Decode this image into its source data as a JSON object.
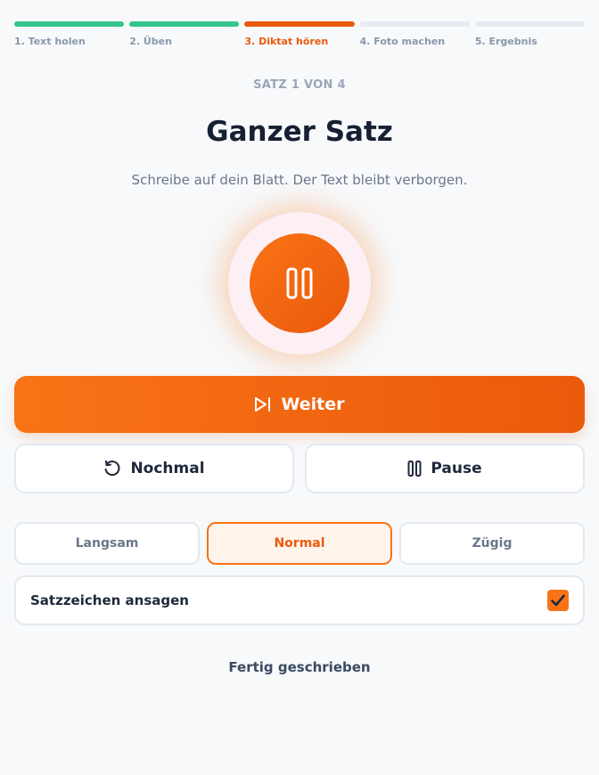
{
  "steps": [
    {
      "label": "1. Text holen",
      "status": "done"
    },
    {
      "label": "2. Üben",
      "status": "done"
    },
    {
      "label": "3. Diktat hören",
      "status": "active"
    },
    {
      "label": "4. Foto machen",
      "status": "todo"
    },
    {
      "label": "5. Ergebnis",
      "status": "todo"
    }
  ],
  "counter": "SATZ 1 VON 4",
  "title": "Ganzer Satz",
  "subtitle": "Schreibe auf dein Blatt. Der Text bleibt verborgen.",
  "player": {
    "icon": "pause-icon"
  },
  "actions": {
    "next_label": "Weiter",
    "next_icon": "skip-forward-icon",
    "replay_label": "Nochmal",
    "replay_icon": "replay-icon",
    "pause_label": "Pause",
    "pause_icon": "pause-icon"
  },
  "speed": {
    "options": [
      "Langsam",
      "Normal",
      "Zügig"
    ],
    "selected": "Normal"
  },
  "punctuation": {
    "label": "Satzzeichen ansagen",
    "checked": true
  },
  "finish_label": "Fertig geschrieben",
  "colors": {
    "accent": "#ea5a0c",
    "accent_light": "#f97316",
    "done": "#34c58d",
    "background": "#f7f9fb"
  }
}
